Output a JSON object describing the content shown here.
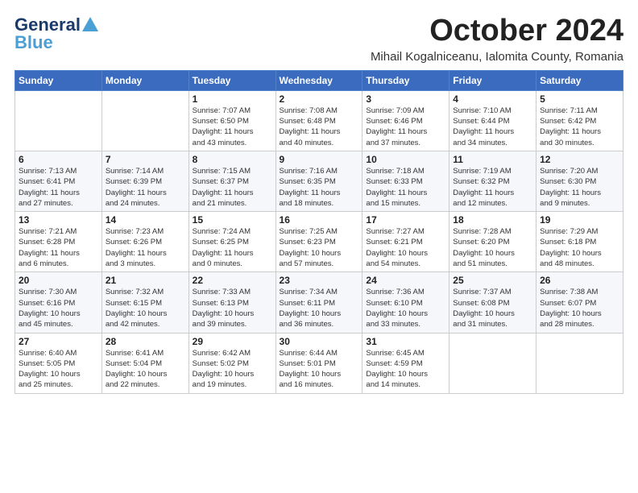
{
  "logo": {
    "line1": "General",
    "line2": "Blue"
  },
  "title": "October 2024",
  "location": "Mihail Kogalniceanu, Ialomita County, Romania",
  "days_of_week": [
    "Sunday",
    "Monday",
    "Tuesday",
    "Wednesday",
    "Thursday",
    "Friday",
    "Saturday"
  ],
  "weeks": [
    [
      {
        "day": "",
        "info": ""
      },
      {
        "day": "",
        "info": ""
      },
      {
        "day": "1",
        "info": "Sunrise: 7:07 AM\nSunset: 6:50 PM\nDaylight: 11 hours\nand 43 minutes."
      },
      {
        "day": "2",
        "info": "Sunrise: 7:08 AM\nSunset: 6:48 PM\nDaylight: 11 hours\nand 40 minutes."
      },
      {
        "day": "3",
        "info": "Sunrise: 7:09 AM\nSunset: 6:46 PM\nDaylight: 11 hours\nand 37 minutes."
      },
      {
        "day": "4",
        "info": "Sunrise: 7:10 AM\nSunset: 6:44 PM\nDaylight: 11 hours\nand 34 minutes."
      },
      {
        "day": "5",
        "info": "Sunrise: 7:11 AM\nSunset: 6:42 PM\nDaylight: 11 hours\nand 30 minutes."
      }
    ],
    [
      {
        "day": "6",
        "info": "Sunrise: 7:13 AM\nSunset: 6:41 PM\nDaylight: 11 hours\nand 27 minutes."
      },
      {
        "day": "7",
        "info": "Sunrise: 7:14 AM\nSunset: 6:39 PM\nDaylight: 11 hours\nand 24 minutes."
      },
      {
        "day": "8",
        "info": "Sunrise: 7:15 AM\nSunset: 6:37 PM\nDaylight: 11 hours\nand 21 minutes."
      },
      {
        "day": "9",
        "info": "Sunrise: 7:16 AM\nSunset: 6:35 PM\nDaylight: 11 hours\nand 18 minutes."
      },
      {
        "day": "10",
        "info": "Sunrise: 7:18 AM\nSunset: 6:33 PM\nDaylight: 11 hours\nand 15 minutes."
      },
      {
        "day": "11",
        "info": "Sunrise: 7:19 AM\nSunset: 6:32 PM\nDaylight: 11 hours\nand 12 minutes."
      },
      {
        "day": "12",
        "info": "Sunrise: 7:20 AM\nSunset: 6:30 PM\nDaylight: 11 hours\nand 9 minutes."
      }
    ],
    [
      {
        "day": "13",
        "info": "Sunrise: 7:21 AM\nSunset: 6:28 PM\nDaylight: 11 hours\nand 6 minutes."
      },
      {
        "day": "14",
        "info": "Sunrise: 7:23 AM\nSunset: 6:26 PM\nDaylight: 11 hours\nand 3 minutes."
      },
      {
        "day": "15",
        "info": "Sunrise: 7:24 AM\nSunset: 6:25 PM\nDaylight: 11 hours\nand 0 minutes."
      },
      {
        "day": "16",
        "info": "Sunrise: 7:25 AM\nSunset: 6:23 PM\nDaylight: 10 hours\nand 57 minutes."
      },
      {
        "day": "17",
        "info": "Sunrise: 7:27 AM\nSunset: 6:21 PM\nDaylight: 10 hours\nand 54 minutes."
      },
      {
        "day": "18",
        "info": "Sunrise: 7:28 AM\nSunset: 6:20 PM\nDaylight: 10 hours\nand 51 minutes."
      },
      {
        "day": "19",
        "info": "Sunrise: 7:29 AM\nSunset: 6:18 PM\nDaylight: 10 hours\nand 48 minutes."
      }
    ],
    [
      {
        "day": "20",
        "info": "Sunrise: 7:30 AM\nSunset: 6:16 PM\nDaylight: 10 hours\nand 45 minutes."
      },
      {
        "day": "21",
        "info": "Sunrise: 7:32 AM\nSunset: 6:15 PM\nDaylight: 10 hours\nand 42 minutes."
      },
      {
        "day": "22",
        "info": "Sunrise: 7:33 AM\nSunset: 6:13 PM\nDaylight: 10 hours\nand 39 minutes."
      },
      {
        "day": "23",
        "info": "Sunrise: 7:34 AM\nSunset: 6:11 PM\nDaylight: 10 hours\nand 36 minutes."
      },
      {
        "day": "24",
        "info": "Sunrise: 7:36 AM\nSunset: 6:10 PM\nDaylight: 10 hours\nand 33 minutes."
      },
      {
        "day": "25",
        "info": "Sunrise: 7:37 AM\nSunset: 6:08 PM\nDaylight: 10 hours\nand 31 minutes."
      },
      {
        "day": "26",
        "info": "Sunrise: 7:38 AM\nSunset: 6:07 PM\nDaylight: 10 hours\nand 28 minutes."
      }
    ],
    [
      {
        "day": "27",
        "info": "Sunrise: 6:40 AM\nSunset: 5:05 PM\nDaylight: 10 hours\nand 25 minutes."
      },
      {
        "day": "28",
        "info": "Sunrise: 6:41 AM\nSunset: 5:04 PM\nDaylight: 10 hours\nand 22 minutes."
      },
      {
        "day": "29",
        "info": "Sunrise: 6:42 AM\nSunset: 5:02 PM\nDaylight: 10 hours\nand 19 minutes."
      },
      {
        "day": "30",
        "info": "Sunrise: 6:44 AM\nSunset: 5:01 PM\nDaylight: 10 hours\nand 16 minutes."
      },
      {
        "day": "31",
        "info": "Sunrise: 6:45 AM\nSunset: 4:59 PM\nDaylight: 10 hours\nand 14 minutes."
      },
      {
        "day": "",
        "info": ""
      },
      {
        "day": "",
        "info": ""
      }
    ]
  ]
}
